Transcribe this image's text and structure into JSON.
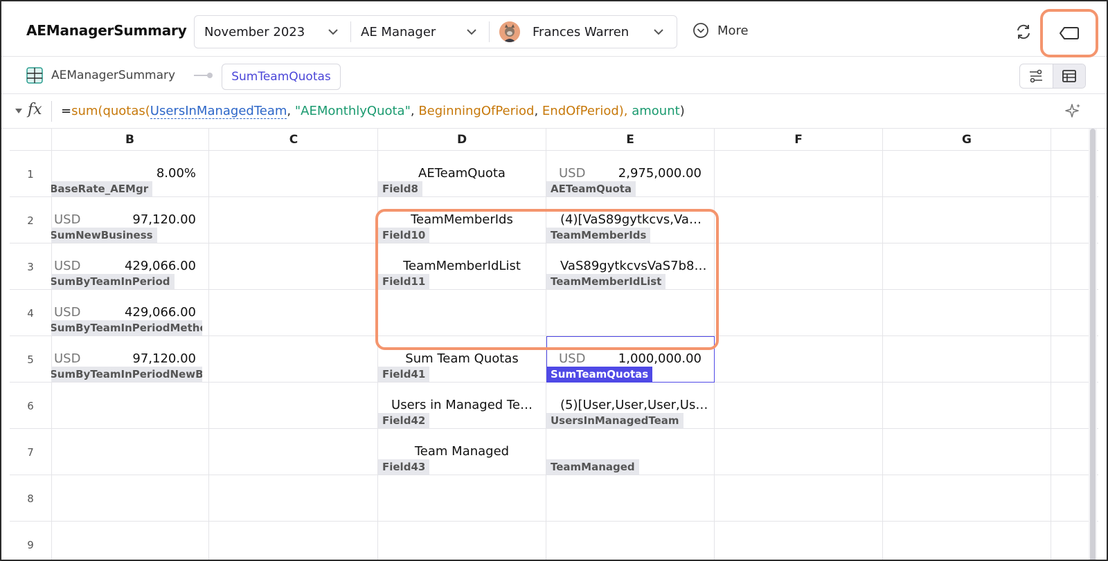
{
  "app": {
    "title": "AEManagerSummary"
  },
  "filters": {
    "period": "November 2023",
    "role": "AE Manager",
    "user": "Frances Warren",
    "more_label": "More"
  },
  "breadcrumb": {
    "sheet": "AEManagerSummary",
    "selected": "SumTeamQuotas"
  },
  "formula": {
    "eq": "=",
    "fn_sum": "sum",
    "p1": "(",
    "fn_quotas": "quotas",
    "p2": "(",
    "ref_users": "UsersInManagedTeam",
    "c1": ", ",
    "str_quota": "\"AEMonthlyQuota\"",
    "c2": ", ",
    "arg_begin": "BeginningOfPeriod",
    "c3": ", ",
    "arg_end": "EndOfPeriod",
    "p3": "), ",
    "fld_amount": "amount",
    "p4": ")"
  },
  "columns": [
    "B",
    "C",
    "D",
    "E",
    "F",
    "G"
  ],
  "rows": [
    "1",
    "2",
    "3",
    "4",
    "5",
    "6",
    "7",
    "8",
    "9"
  ],
  "cells": {
    "B1": {
      "value": "8.00%",
      "tag": "BaseRate_AEMgr"
    },
    "B2": {
      "currency": "USD",
      "value": "97,120.00",
      "tag": "SumNewBusiness"
    },
    "B3": {
      "currency": "USD",
      "value": "429,066.00",
      "tag": "SumByTeamInPeriod"
    },
    "B4": {
      "currency": "USD",
      "value": "429,066.00",
      "tag": "SumByTeamInPeriodMetho…"
    },
    "B5": {
      "currency": "USD",
      "value": "97,120.00",
      "tag": "SumByTeamInPeriodNewBu…"
    },
    "D1": {
      "value": "AETeamQuota",
      "tag": "Field8"
    },
    "D2": {
      "value": "TeamMemberIds",
      "tag": "Field10"
    },
    "D3": {
      "value": "TeamMemberIdList",
      "tag": "Field11"
    },
    "D5": {
      "value": "Sum Team Quotas",
      "tag": "Field41"
    },
    "D6": {
      "value": "Users in Managed Te…",
      "tag": "Field42"
    },
    "D7": {
      "value": "Team Managed",
      "tag": "Field43"
    },
    "E1": {
      "currency": "USD",
      "value": "2,975,000.00",
      "tag": "AETeamQuota"
    },
    "E2": {
      "value": "(4)[VaS89gytkcvs,Va…",
      "tag": "TeamMemberIds"
    },
    "E3": {
      "value": "VaS89gytkcvsVaS7b8…",
      "tag": "TeamMemberIdList"
    },
    "E5": {
      "currency": "USD",
      "value": "1,000,000.00",
      "tag": "SumTeamQuotas"
    },
    "E6": {
      "value": "(5)[User,User,User,Us…",
      "tag": "UsersInManagedTeam"
    },
    "E7": {
      "value": "",
      "tag": "TeamManaged"
    }
  },
  "colors": {
    "accent": "#4f49e6",
    "highlight": "#f4956e",
    "tag_bg": "#e6e7ec"
  }
}
